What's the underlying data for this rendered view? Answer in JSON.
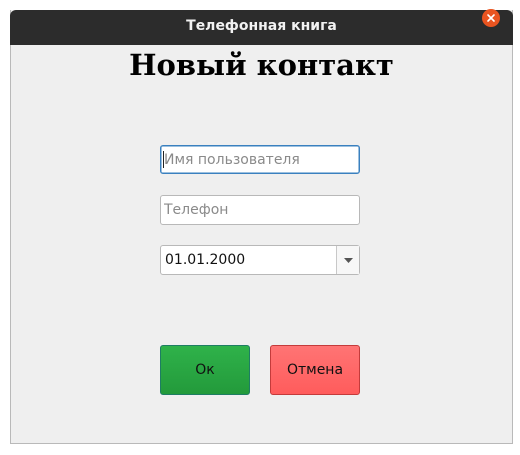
{
  "window": {
    "title": "Телефонная книга"
  },
  "form": {
    "heading": "Новый контакт",
    "username_placeholder": "Имя пользователя",
    "username_value": "",
    "phone_placeholder": "Телефон",
    "phone_value": "",
    "date_value": "01.01.2000"
  },
  "buttons": {
    "ok_label": "Ок",
    "cancel_label": "Отмена"
  },
  "colors": {
    "titlebar": "#2c2c2c",
    "close_button": "#e95420",
    "ok_button": "#2aa845",
    "cancel_button": "#ff6666",
    "focus_border": "#3a80bf"
  },
  "icons": {
    "close": "close-icon",
    "dropdown": "chevron-down-icon"
  }
}
